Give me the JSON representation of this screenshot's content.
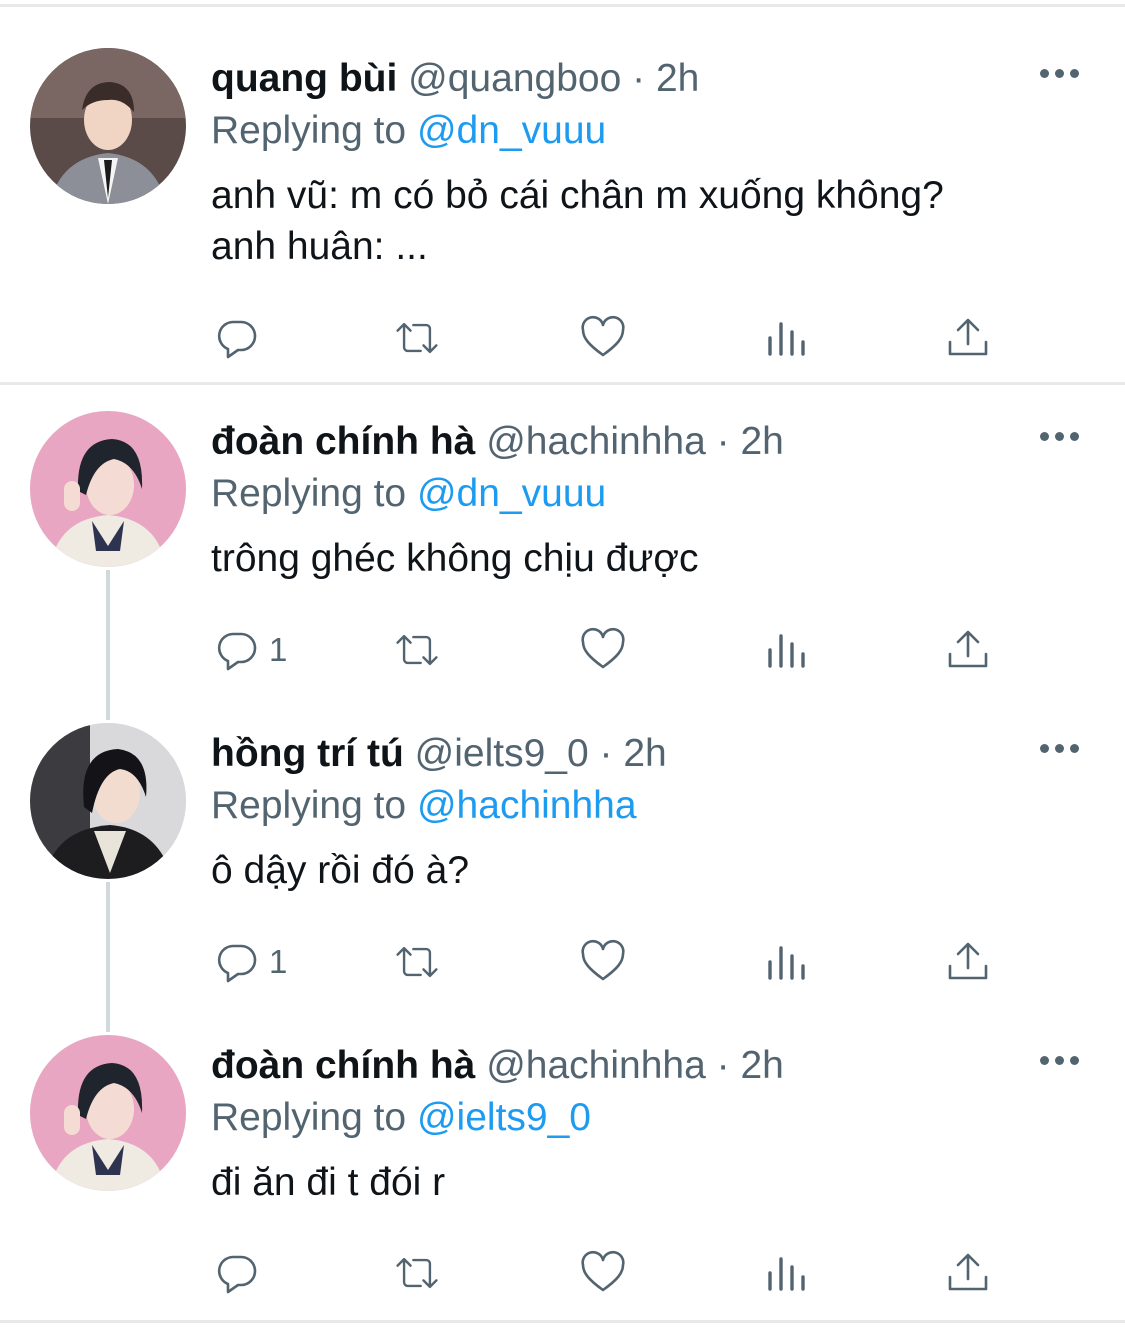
{
  "tweets": [
    {
      "name": "quang bùi",
      "handle": "@quangboo",
      "sep": "·",
      "time": "2h",
      "replying_label": "Replying to",
      "replying_to": "@dn_vuuu",
      "lines": [
        "anh vũ: m có bỏ cái chân m xuống không?",
        "anh huân: ..."
      ],
      "reply_count": ""
    },
    {
      "name": "đoàn chính hà",
      "handle": "@hachinhha",
      "sep": "·",
      "time": "2h",
      "replying_label": "Replying to",
      "replying_to": "@dn_vuuu",
      "lines": [
        "trông ghéc không chịu được"
      ],
      "reply_count": "1"
    },
    {
      "name": "hồng trí tú",
      "handle": "@ielts9_0",
      "sep": "·",
      "time": "2h",
      "replying_label": "Replying to",
      "replying_to": "@hachinhha",
      "lines": [
        "ô dậy rồi đó à?"
      ],
      "reply_count": "1"
    },
    {
      "name": "đoàn chính hà",
      "handle": "@hachinhha",
      "sep": "·",
      "time": "2h",
      "replying_label": "Replying to",
      "replying_to": "@ielts9_0",
      "lines": [
        "đi ăn đi t đói r"
      ],
      "reply_count": ""
    }
  ],
  "icons": {
    "more": "more-horizontal-icon",
    "reply": "reply-bubble-icon",
    "retweet": "retweet-icon",
    "like": "heart-icon",
    "analytics": "analytics-bars-icon",
    "share": "share-upload-icon"
  },
  "colors": {
    "mention": "#1d9bf0",
    "secondary": "#536471",
    "primary": "#0f1419",
    "divider": "#e7e9ea",
    "thread_line": "#cfd9de"
  }
}
